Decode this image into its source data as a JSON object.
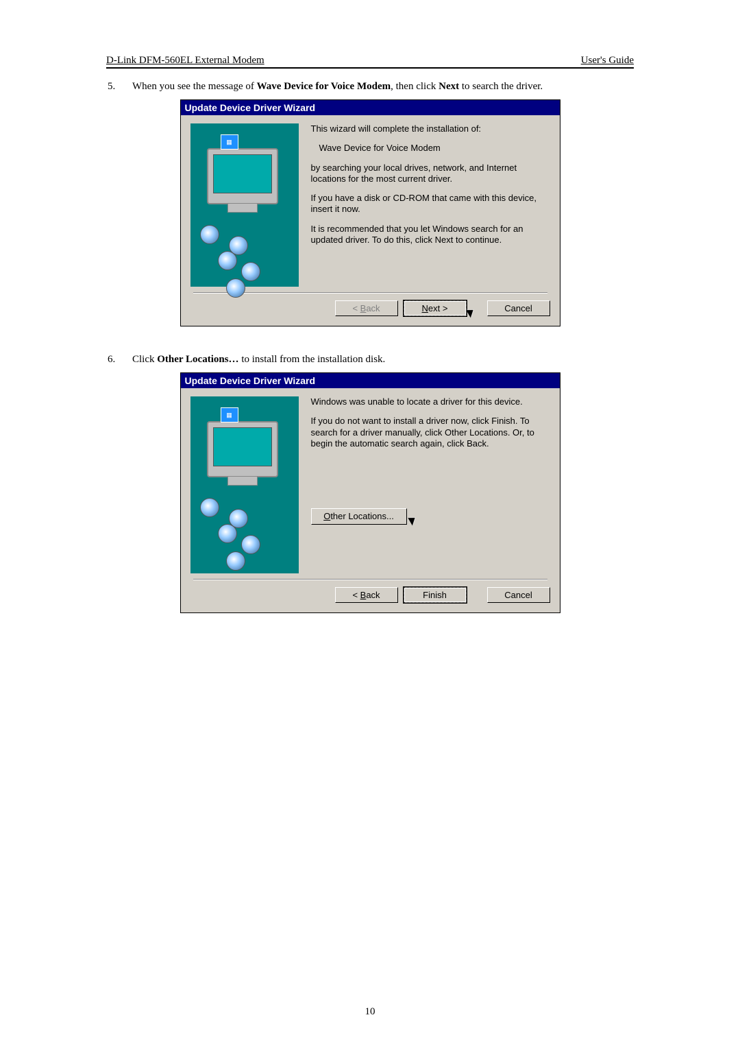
{
  "header": {
    "left": "D-Link DFM-560EL External Modem",
    "right": "User's Guide"
  },
  "steps": [
    {
      "num": "5.",
      "pre": "When you see the message of ",
      "bold1": "Wave Device for Voice Modem",
      "mid": ", then click ",
      "bold2": "Next",
      "post": " to search the driver."
    },
    {
      "num": "6.",
      "pre": "Click ",
      "bold1": "Other Locations…",
      "mid": " to install from the installation disk.",
      "bold2": "",
      "post": ""
    }
  ],
  "dialog1": {
    "title": "Update Device Driver Wizard",
    "p1": "This wizard will complete the installation of:",
    "device": "Wave Device for Voice Modem",
    "p2": "by searching your local drives, network, and Internet locations for the most current driver.",
    "p3": "If you have a disk or CD-ROM that came with this device, insert it now.",
    "p4": "It is recommended that you let Windows search for an updated driver. To do this, click Next to continue.",
    "back": "< Back",
    "next": "Next >",
    "cancel": "Cancel"
  },
  "dialog2": {
    "title": "Update Device Driver Wizard",
    "p1": "Windows was unable to locate a driver for this device.",
    "p2": "If you do not want to install a driver now, click Finish. To search for a driver manually, click Other Locations. Or, to begin the automatic search again, click Back.",
    "other": "Other Locations...",
    "back": "< Back",
    "finish": "Finish",
    "cancel": "Cancel"
  },
  "page_num": "10"
}
